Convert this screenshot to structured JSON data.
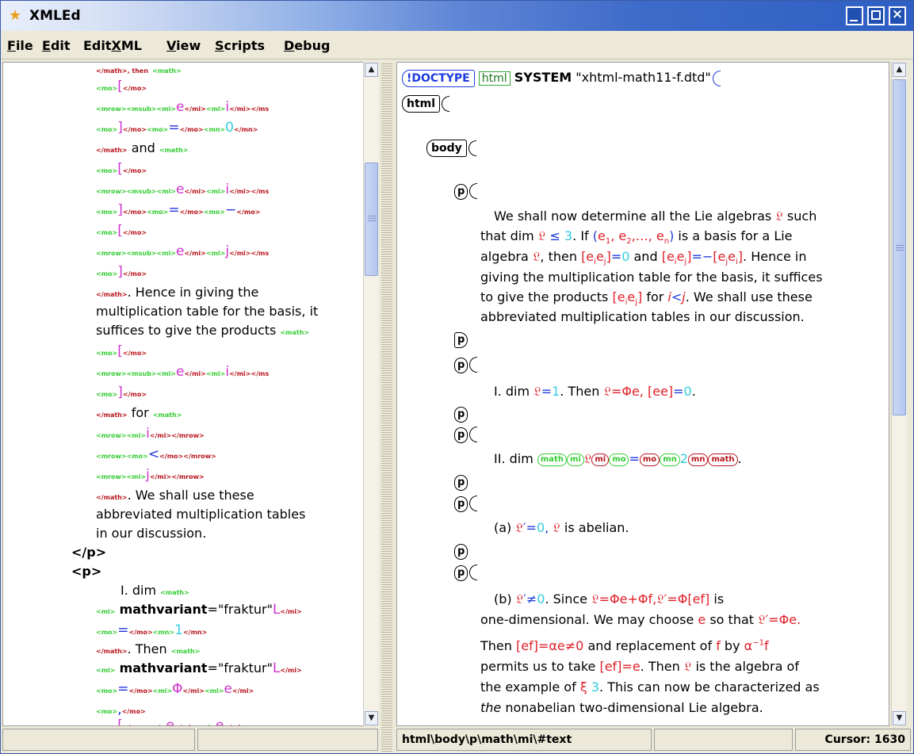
{
  "window": {
    "title": "XMLEd"
  },
  "menu": {
    "file": {
      "pre": "",
      "u": "F",
      "post": "ile"
    },
    "edit": {
      "pre": "",
      "u": "E",
      "post": "dit"
    },
    "editxml": {
      "pre": "Edit",
      "u": "X",
      "post": "ML"
    },
    "view": {
      "pre": "",
      "u": "V",
      "post": "iew"
    },
    "scripts": {
      "pre": "",
      "u": "S",
      "post": "cripts"
    },
    "debug": {
      "pre": "",
      "u": "D",
      "post": "ebug"
    }
  },
  "left": {
    "l1": {
      "a": "</math>, then",
      "b": "<math>"
    },
    "mo_open": "<mo>",
    "mo_close": "</mo>",
    "mrow": "<mrow>",
    "msub": "<msub>",
    "mi": "<mi>",
    "mi_close": "</mi>",
    "ms_close": "</ms",
    "mn": "<mn>",
    "mn_close": "</mn>",
    "math_close": "</math>",
    "math_open": "<math>",
    "mrow_close": "</mrow>",
    "bracket_open": "[",
    "bracket_close": "]",
    "e": "e",
    "i": "i",
    "j": "j",
    "eq": "=",
    "zero": "0",
    "minus": "−",
    "lt": "<",
    "one": "1",
    "comma": ",",
    "phi": "Φ",
    "and": "and",
    "for": "for",
    "t1": ". Hence in giving the",
    "t2": "multiplication table for the basis, it",
    "t3": "suffices to give the products",
    "t4": ". We shall use these",
    "t5": "abbreviated multiplication tables",
    "t6": "in our discussion.",
    "p_close": "</p>",
    "p_open": "<p>",
    "dim1": "I. dim",
    "mathvariant": "mathvariant",
    "fraktur": "=\"fraktur\"",
    "L": "L",
    "then": ". Then"
  },
  "right": {
    "doctype": "!DOCTYPE",
    "html_kw": "html",
    "system": "SYSTEM",
    "dtd": "\"xhtml-math11-f.dtd\"",
    "html_tag": "html",
    "body_tag": "body",
    "p_tag": "p",
    "para1": {
      "l1": "We shall now determine all the Lie algebras",
      "l1b": "such",
      "l2a": "that dim",
      "l2b": "≤",
      "l2c": "3",
      "l2d": ". If",
      "l2e": "(e",
      "l2f": "is a basis for a Lie",
      "l3a": "algebra",
      "l3b": ", then",
      "l3c": "=0",
      "l3d": "and",
      "l3e": "=−[e",
      "l3f": ". Hence in",
      "l4": "giving the multiplication table for the basis, it suffices",
      "l5a": "to give the products",
      "l5b": "for",
      "l5c": ". We shall use these",
      "l6": "abbreviated multiplication tables in our discussion."
    },
    "para2": {
      "a": "I. dim",
      "b": "=",
      "c": "1",
      "d": ". Then",
      "e": "=Φe,",
      "f": "[ee]",
      "g": "=",
      "h": "0",
      "i": "."
    },
    "para3": {
      "a": "II. dim",
      "math": "math",
      "mi": "mi",
      "mo": "mo",
      "mn": "mn",
      "eq": "=",
      "two": "2",
      "dot": "."
    },
    "para4": {
      "a": "(a)",
      "b": "′=",
      "c": "0",
      "d": ",",
      "e": "is abelian."
    },
    "para5": {
      "l1a": "(b)",
      "l1b": "′≠",
      "l1c": "0",
      "l1d": ". Since",
      "l1e": "=Φe+Φf,",
      "l1f": "′=Φ[ef]",
      "l1g": "is",
      "l2a": "one-dimensional. We may choose",
      "l2b": "e",
      "l2c": "so that",
      "l2d": "′=Φe.",
      "l3a": "Then",
      "l3b": "[ef]=αe≠0",
      "l3c": "and replacement of",
      "l3d": "f",
      "l3e": "by",
      "l3f": "α",
      "l3g": "−1",
      "l3h": "f",
      "l4a": "permits us to take",
      "l4b": "[ef]=e",
      "l4c": ". Then",
      "l4d": "is the algebra of",
      "l5a": "the example of",
      "l5b": "ξ",
      "l5c": "3",
      "l5d": ". This can now be characterized as",
      "l6a": "the",
      "l6b": "nonabelian two-dimensional Lie algebra."
    }
  },
  "status": {
    "left1": "",
    "left2": "",
    "path": "html\\body\\p\\math\\mi\\#text",
    "mid": "",
    "cursor": "Cursor: 1630"
  }
}
